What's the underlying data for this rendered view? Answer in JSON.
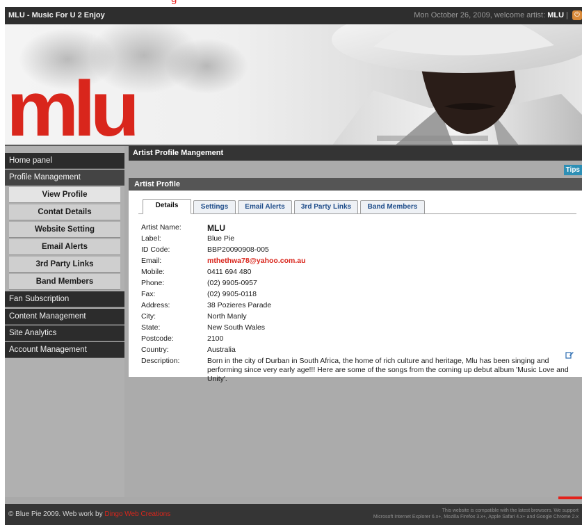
{
  "top_caption": "g",
  "window": {
    "title": "MLU - Music For U 2 Enjoy",
    "date_text": "Mon October 26, 2009, welcome artist:",
    "user": "MLU"
  },
  "banner": {
    "logo_text": "mlu"
  },
  "sidebar": {
    "items": [
      {
        "label": "Home panel",
        "kind": "main"
      },
      {
        "label": "Profile Management",
        "kind": "main"
      },
      {
        "label": "View Profile",
        "kind": "sub"
      },
      {
        "label": "Contat Details",
        "kind": "sub"
      },
      {
        "label": "Website Setting",
        "kind": "sub"
      },
      {
        "label": "Email Alerts",
        "kind": "sub"
      },
      {
        "label": "3rd Party Links",
        "kind": "sub"
      },
      {
        "label": "Band Members",
        "kind": "sub"
      },
      {
        "label": "Fan Subscription",
        "kind": "main"
      },
      {
        "label": "Content Management",
        "kind": "main"
      },
      {
        "label": "Site Analytics",
        "kind": "main"
      },
      {
        "label": "Account Management",
        "kind": "main"
      }
    ]
  },
  "main": {
    "page_header": "Artist Profile Mangement",
    "tips_label": "Tips",
    "card_title": "Artist Profile",
    "tabs": [
      {
        "label": "Details",
        "active": true
      },
      {
        "label": "Settings",
        "active": false
      },
      {
        "label": "Email Alerts",
        "active": false
      },
      {
        "label": "3rd Party Links",
        "active": false
      },
      {
        "label": "Band Members",
        "active": false
      }
    ],
    "details": [
      {
        "label": "Artist Name:",
        "value": "MLU"
      },
      {
        "label": "Label:",
        "value": "Blue Pie"
      },
      {
        "label": "ID Code:",
        "value": "BBP20090908-005"
      },
      {
        "label": "Email:",
        "value": "mthethwa78@yahoo.com.au"
      },
      {
        "label": "Mobile:",
        "value": "0411 694 480"
      },
      {
        "label": "Phone:",
        "value": "(02) 9905-0957"
      },
      {
        "label": "Fax:",
        "value": "(02) 9905-0118"
      },
      {
        "label": "Address:",
        "value": "38 Pozieres Parade"
      },
      {
        "label": "City:",
        "value": "North Manly"
      },
      {
        "label": "State:",
        "value": "New South Wales"
      },
      {
        "label": "Postcode:",
        "value": "2100"
      },
      {
        "label": "Country:",
        "value": "Australia"
      },
      {
        "label": "Description:",
        "value": "Born in the city of Durban in South Africa, the home of rich culture and heritage, Mlu has been singing and performing since very early age!!! Here are some of the songs from the coming up debut album 'Music Love and Unity'."
      }
    ]
  },
  "footer": {
    "copyright": "© Blue Pie 2009. Web work by",
    "credit": "Dingo Web Creations",
    "compat_line1": "This website is compatible with the latest browsers. We support",
    "compat_line2": "Microsoft Internet Explorer 6.x+, Mozilla Firefox 3.x+, Apple Safari 4.x+ and Google Chrome 2.x"
  },
  "colors": {
    "brand_red": "#d9261c",
    "header_dark": "#2e2e2e",
    "tips_blue": "#2d8fb5"
  },
  "icons": {
    "power": "power-icon",
    "edit": "edit-icon"
  }
}
